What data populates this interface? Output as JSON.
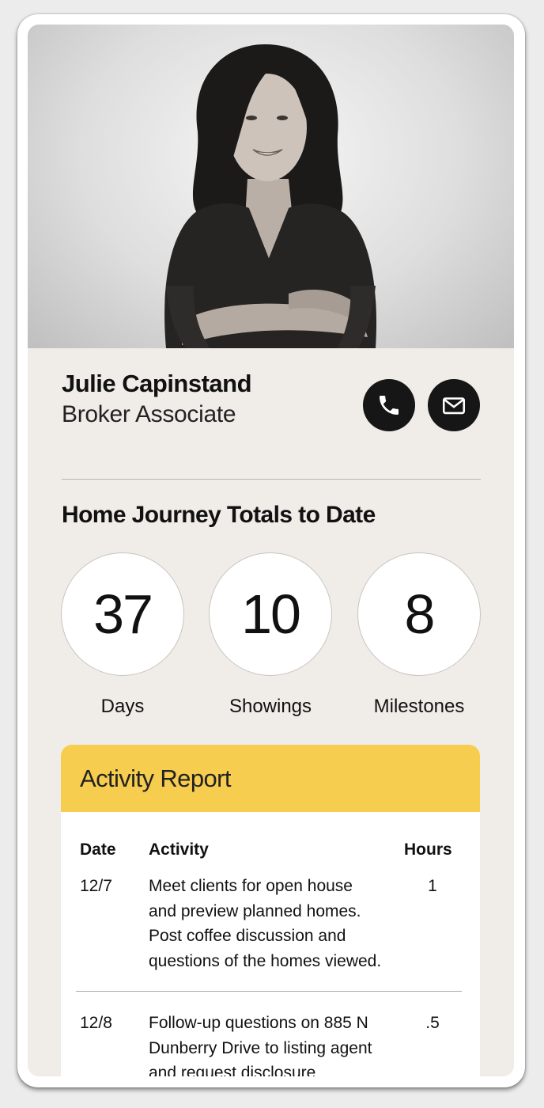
{
  "agent": {
    "name": "Julie Capinstand",
    "title": "Broker Associate"
  },
  "actions": {
    "call_icon": "phone-icon",
    "email_icon": "mail-icon"
  },
  "totals": {
    "heading": "Home Journey Totals to Date",
    "stats": [
      {
        "value": "37",
        "label": "Days"
      },
      {
        "value": "10",
        "label": "Showings"
      },
      {
        "value": "8",
        "label": "Milestones"
      }
    ]
  },
  "report": {
    "title": "Activity Report",
    "accent_color": "#f7cd4f",
    "columns": [
      "Date",
      "Activity",
      "Hours"
    ],
    "rows": [
      {
        "date": "12/7",
        "activity": [
          "Meet clients for open house",
          "and preview planned homes.",
          "Post coffee discussion and",
          "questions of the homes viewed."
        ],
        "hours": "1"
      },
      {
        "date": "12/8",
        "activity": [
          "Follow-up questions on 885 N",
          "Dunberry Drive to listing agent",
          "and request disclosure"
        ],
        "hours": ".5"
      }
    ]
  }
}
